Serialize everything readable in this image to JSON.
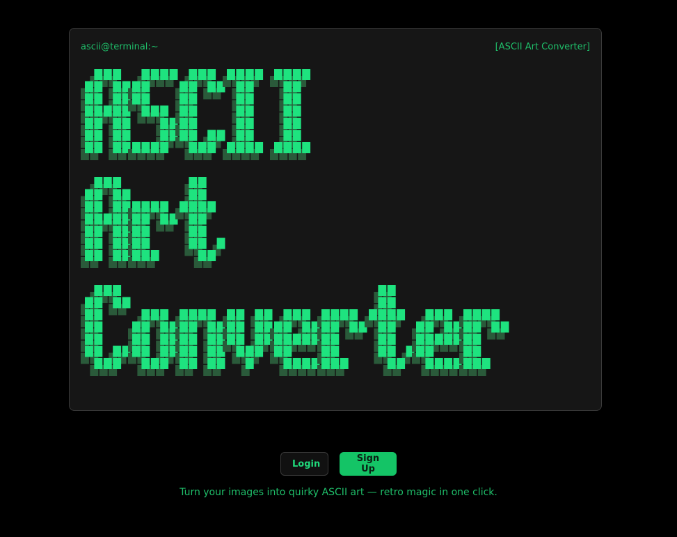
{
  "terminal": {
    "prompt": "ascii@terminal:~",
    "title": "[ASCII Art Converter]"
  },
  "ascii_art": {
    "lines": [
      "ASCII",
      "Art",
      "Converter"
    ],
    "color": "#1ee37f",
    "shade_color": "#2a5a3a"
  },
  "buttons": {
    "login": "Login",
    "signup": "Sign Up"
  },
  "tagline": "Turn your images into quirky ASCII art — retro magic in one click.",
  "colors": {
    "background": "#000000",
    "panel": "#161616",
    "accent": "#14c466",
    "text_green": "#1fbf6a"
  }
}
